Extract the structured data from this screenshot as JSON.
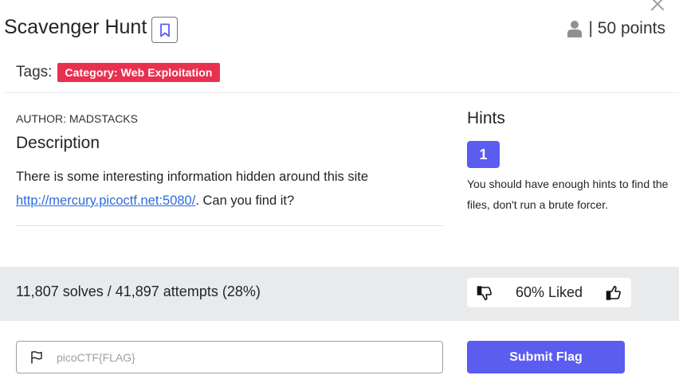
{
  "challenge": {
    "title": "Scavenger Hunt",
    "points": "| 50 points",
    "tags_label": "Tags:",
    "tags": [
      "Category: Web Exploitation"
    ],
    "author": "AUTHOR: MADSTACKS",
    "description_heading": "Description",
    "description_text": "There is some interesting information hidden around this site ",
    "description_link": "http://mercury.picoctf.net:5080/",
    "description_suffix": ". Can you find it?"
  },
  "hints": {
    "heading": "Hints",
    "items": [
      {
        "number": "1",
        "text": "You should have enough hints to find the files, don't run a brute forcer."
      }
    ]
  },
  "stats": {
    "solves": "11,807 solves / 41,897 attempts (28%)",
    "liked": "60% Liked"
  },
  "flag_form": {
    "placeholder": "picoCTF{FLAG}",
    "value": "",
    "submit_label": "Submit Flag"
  },
  "colors": {
    "accent": "#5b5cf0",
    "tag_bg": "#e8314f",
    "link": "#2d6ae3",
    "stats_band": "#e9eaeb"
  },
  "icons": [
    "close-icon",
    "bookmark-icon",
    "user-icon",
    "thumbs-down-icon",
    "thumbs-up-icon",
    "flag-icon"
  ]
}
